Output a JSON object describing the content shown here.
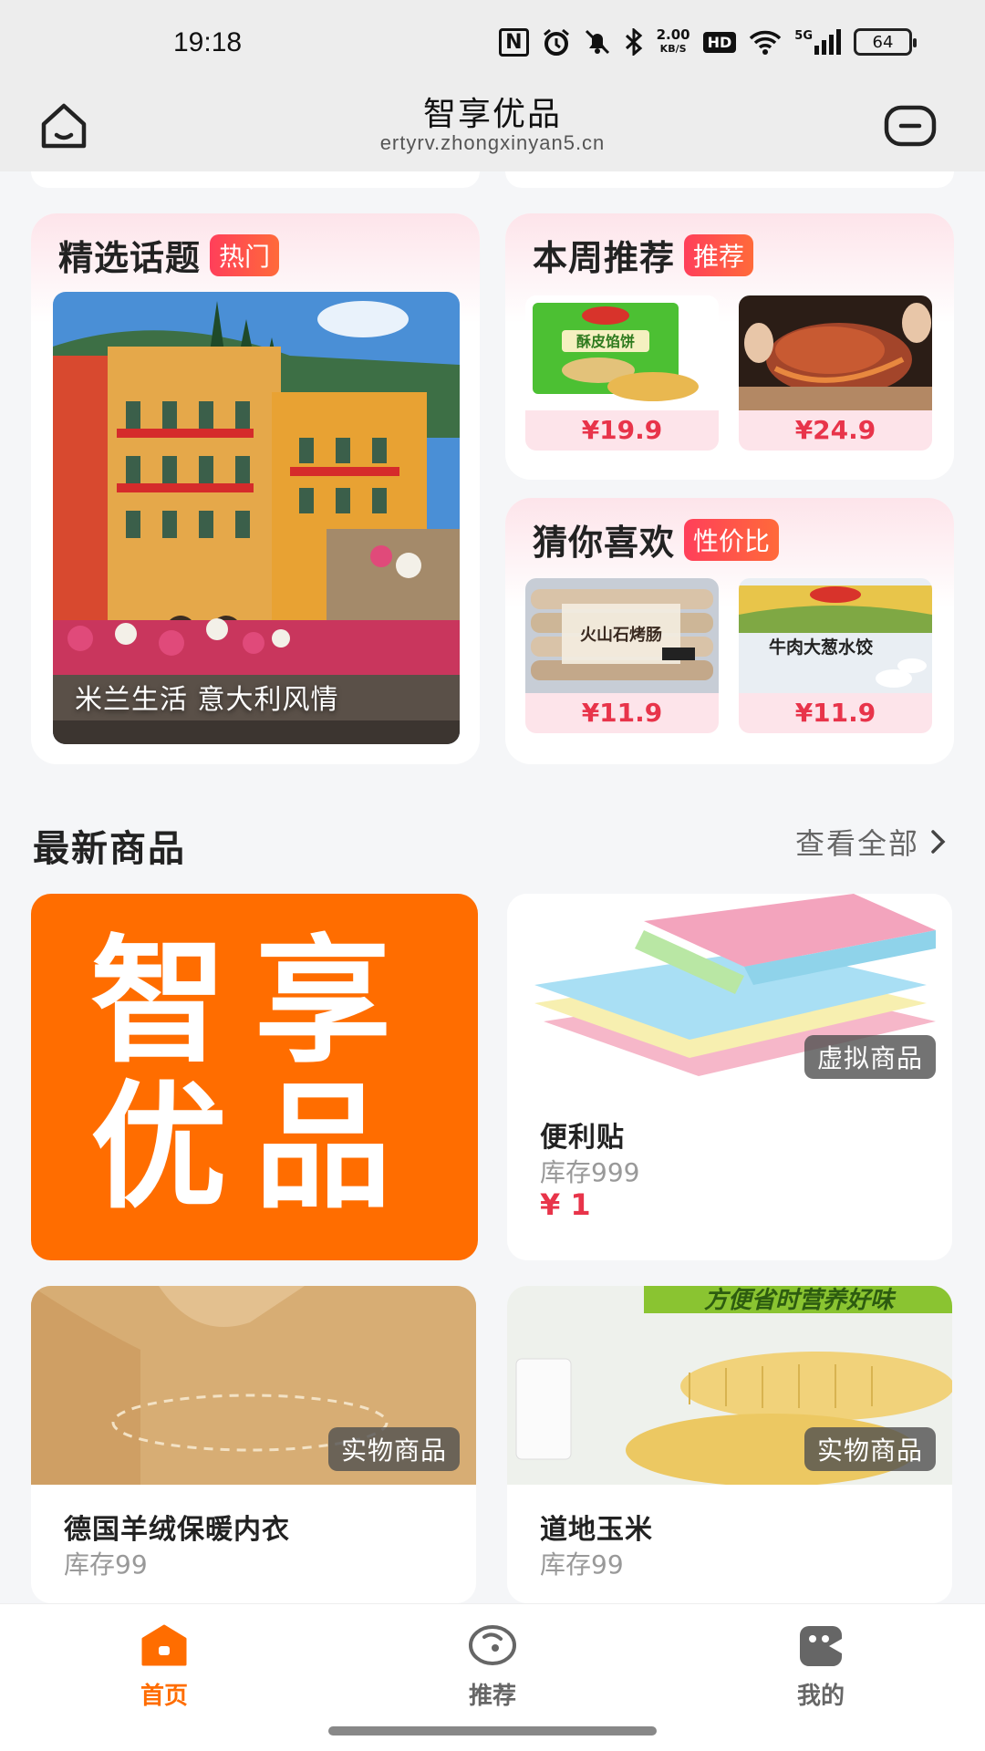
{
  "status_bar": {
    "time": "19:18",
    "nfc": "N",
    "net_speed_value": "2.00",
    "net_speed_unit": "KB/S",
    "hd": "HD",
    "network": "5G",
    "battery": "64"
  },
  "browser": {
    "title": "智享优品",
    "url": "ertyrv.zhongxinyan5.cn"
  },
  "featured_topics": {
    "title": "精选话题",
    "tag": "热门",
    "caption": "米兰生活 意大利风情"
  },
  "weekly_picks": {
    "title": "本周推荐",
    "tag": "推荐",
    "items": [
      {
        "price": "¥19.9",
        "pack_text": "酥皮馅饼"
      },
      {
        "price": "¥24.9"
      }
    ]
  },
  "guess_you_like": {
    "title": "猜你喜欢",
    "tag": "性价比",
    "items": [
      {
        "price": "¥11.9",
        "pack_text": "火山石烤肠"
      },
      {
        "price": "¥11.9",
        "pack_text": "牛肉大葱水饺"
      }
    ]
  },
  "latest": {
    "title": "最新商品",
    "see_all": "查看全部",
    "brand_line1": "智享",
    "brand_line2": "优品",
    "products": [
      {
        "badge": "虚拟商品",
        "name": "便利贴",
        "stock": "库存999",
        "price": "¥ 1"
      },
      {
        "badge": "实物商品",
        "name": "德国羊绒保暖内衣",
        "stock": "库存99"
      },
      {
        "badge": "实物商品",
        "name": "道地玉米",
        "stock": "库存99",
        "banner": "方便省时营养好味"
      }
    ]
  },
  "bottom_nav": {
    "items": [
      {
        "label": "首页",
        "active": true
      },
      {
        "label": "推荐",
        "active": false
      },
      {
        "label": "我的",
        "active": false
      }
    ],
    "active_color": "#ff6d00",
    "inactive_color": "#666666"
  }
}
